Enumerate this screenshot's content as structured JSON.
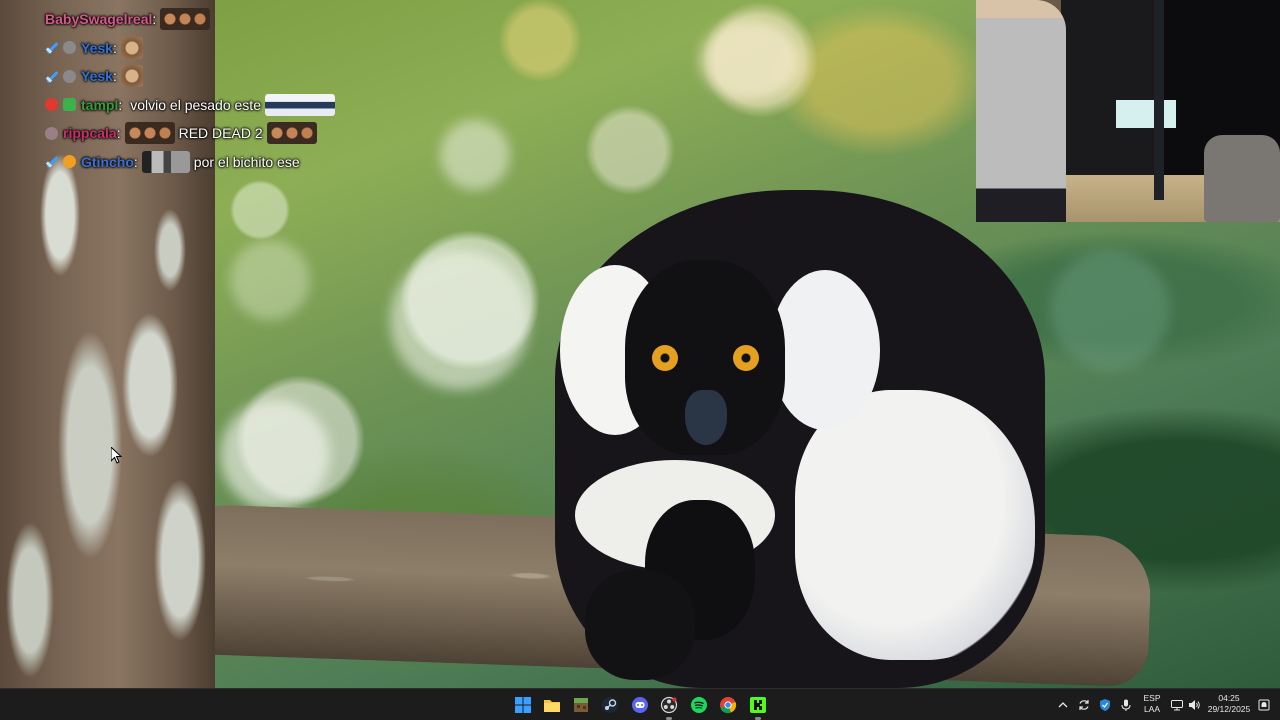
{
  "chat": {
    "lines": [
      {
        "username": "BabySwagelreal",
        "user_color": "#d5598a",
        "message": ""
      },
      {
        "username": "Yesk",
        "user_color": "#2f73d8",
        "message": ""
      },
      {
        "username": "Yesk",
        "user_color": "#2f73d8",
        "message": ""
      },
      {
        "username": "tampl",
        "user_color": "#3b9a3b",
        "message": "volvio el pesado este"
      },
      {
        "username": "rippcala",
        "user_color": "#c8306a",
        "message": "RED DEAD 2"
      },
      {
        "username": "Gtincho",
        "user_color": "#3c6fd6",
        "message": "por el bichito ese"
      }
    ]
  },
  "taskbar": {
    "icons": [
      {
        "name": "windows-start-icon",
        "color": "#3aa0ff"
      },
      {
        "name": "file-explorer-icon",
        "color": "#f5c542"
      },
      {
        "name": "minecraft-icon",
        "color": "#6aa84f"
      },
      {
        "name": "steam-icon",
        "color": "#c7d5e0"
      },
      {
        "name": "discord-icon",
        "color": "#5865f2"
      },
      {
        "name": "obs-icon",
        "color": "#d8d8d8"
      },
      {
        "name": "spotify-icon",
        "color": "#1ed760"
      },
      {
        "name": "chrome-icon",
        "color": "#4285f4"
      },
      {
        "name": "streaming-app-icon",
        "color": "#53fc18"
      }
    ],
    "tray": {
      "language_line1": "ESP",
      "language_line2": "LAA",
      "time": "04:25",
      "date": "29/12/2025"
    }
  }
}
